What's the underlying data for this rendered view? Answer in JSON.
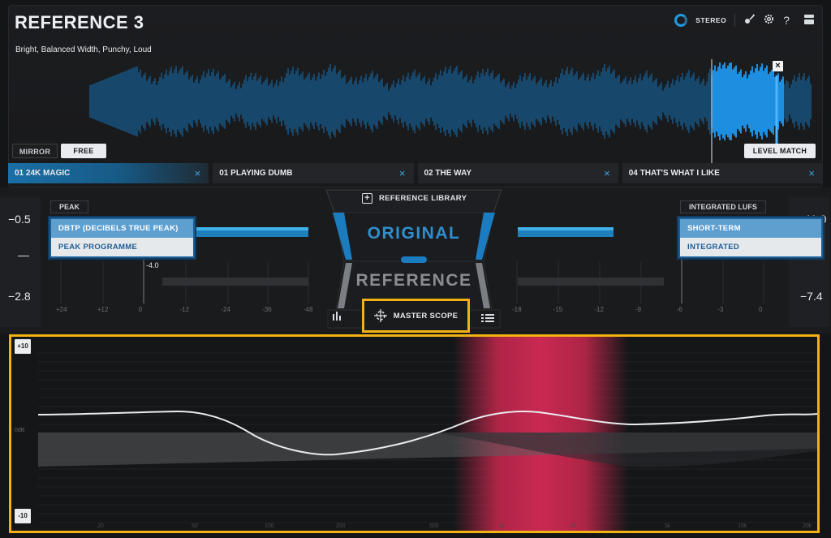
{
  "header": {
    "title": "REFERENCE 3",
    "tags": "Bright,  Balanced Width,  Punchy,  Loud",
    "stereo_label": "STEREO",
    "help_label": "?"
  },
  "waveform": {
    "close_label": "×",
    "mirror_label": "MIRROR",
    "free_label": "FREE",
    "level_match_label": "LEVEL MATCH"
  },
  "tracks": [
    {
      "name": "01 24K MAGIC",
      "remove": "×"
    },
    {
      "name": "01 PLAYING DUMB",
      "remove": "×"
    },
    {
      "name": "02 THE WAY",
      "remove": "×"
    },
    {
      "name": "04 THAT'S WHAT I LIKE",
      "remove": "×"
    }
  ],
  "left_meter": {
    "value_top": "−0.5",
    "dash": "—",
    "value_bottom": "−2.8",
    "label": "PEAK",
    "marker": "-4.0",
    "options": [
      "DBTP (DECIBELS TRUE PEAK)",
      "PEAK PROGRAMME"
    ],
    "scale": [
      "+24",
      "+12",
      "0",
      "-12",
      "-24",
      "-36",
      "-48"
    ]
  },
  "right_meter": {
    "value_top": "−11.0",
    "value_bottom": "−7.4",
    "label": "INTEGRATED LUFS",
    "options": [
      "SHORT-TERM",
      "INTEGRATED"
    ],
    "scale": [
      "-18",
      "-15",
      "-12",
      "-9",
      "-6",
      "-3",
      "0"
    ]
  },
  "center": {
    "reference_library": "REFERENCE LIBRARY",
    "original": "ORIGINAL",
    "reference": "REFERENCE",
    "master_scope": "MASTER SCOPE"
  },
  "scope": {
    "top_db": "+10",
    "bottom_db": "-10",
    "zero_db": "0dB",
    "freqs": [
      "20",
      "50",
      "100",
      "200",
      "500",
      "1k",
      "2k",
      "5k",
      "10k",
      "20k"
    ]
  },
  "colors": {
    "accent": "#2e8fcf",
    "highlight": "#f2b213",
    "band": "#c8274e"
  }
}
